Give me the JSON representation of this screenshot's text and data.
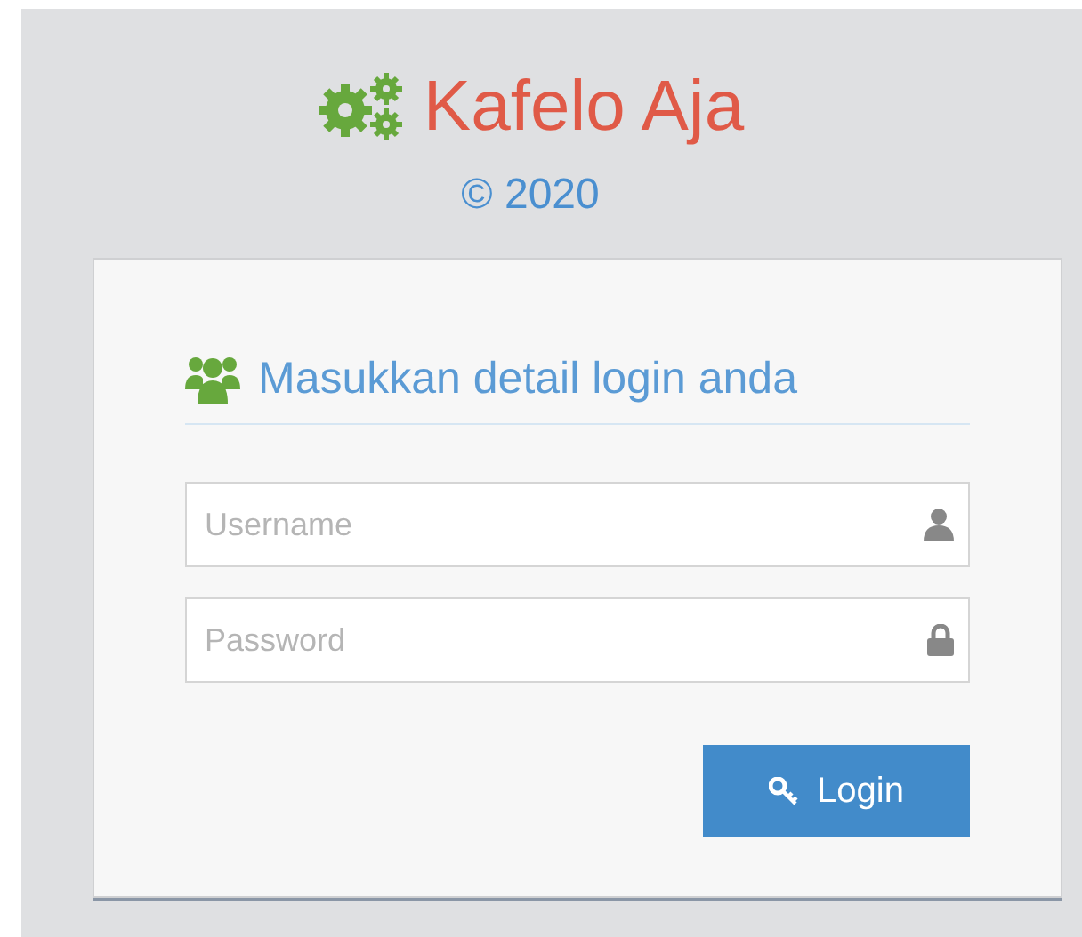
{
  "brand": {
    "title": "Kafelo Aja",
    "copyright": "© 2020"
  },
  "login": {
    "heading": "Masukkan detail login anda",
    "fields": [
      {
        "kind": "text",
        "placeholder": "Username"
      },
      {
        "kind": "password",
        "placeholder": "Password"
      }
    ],
    "button": "Login"
  }
}
